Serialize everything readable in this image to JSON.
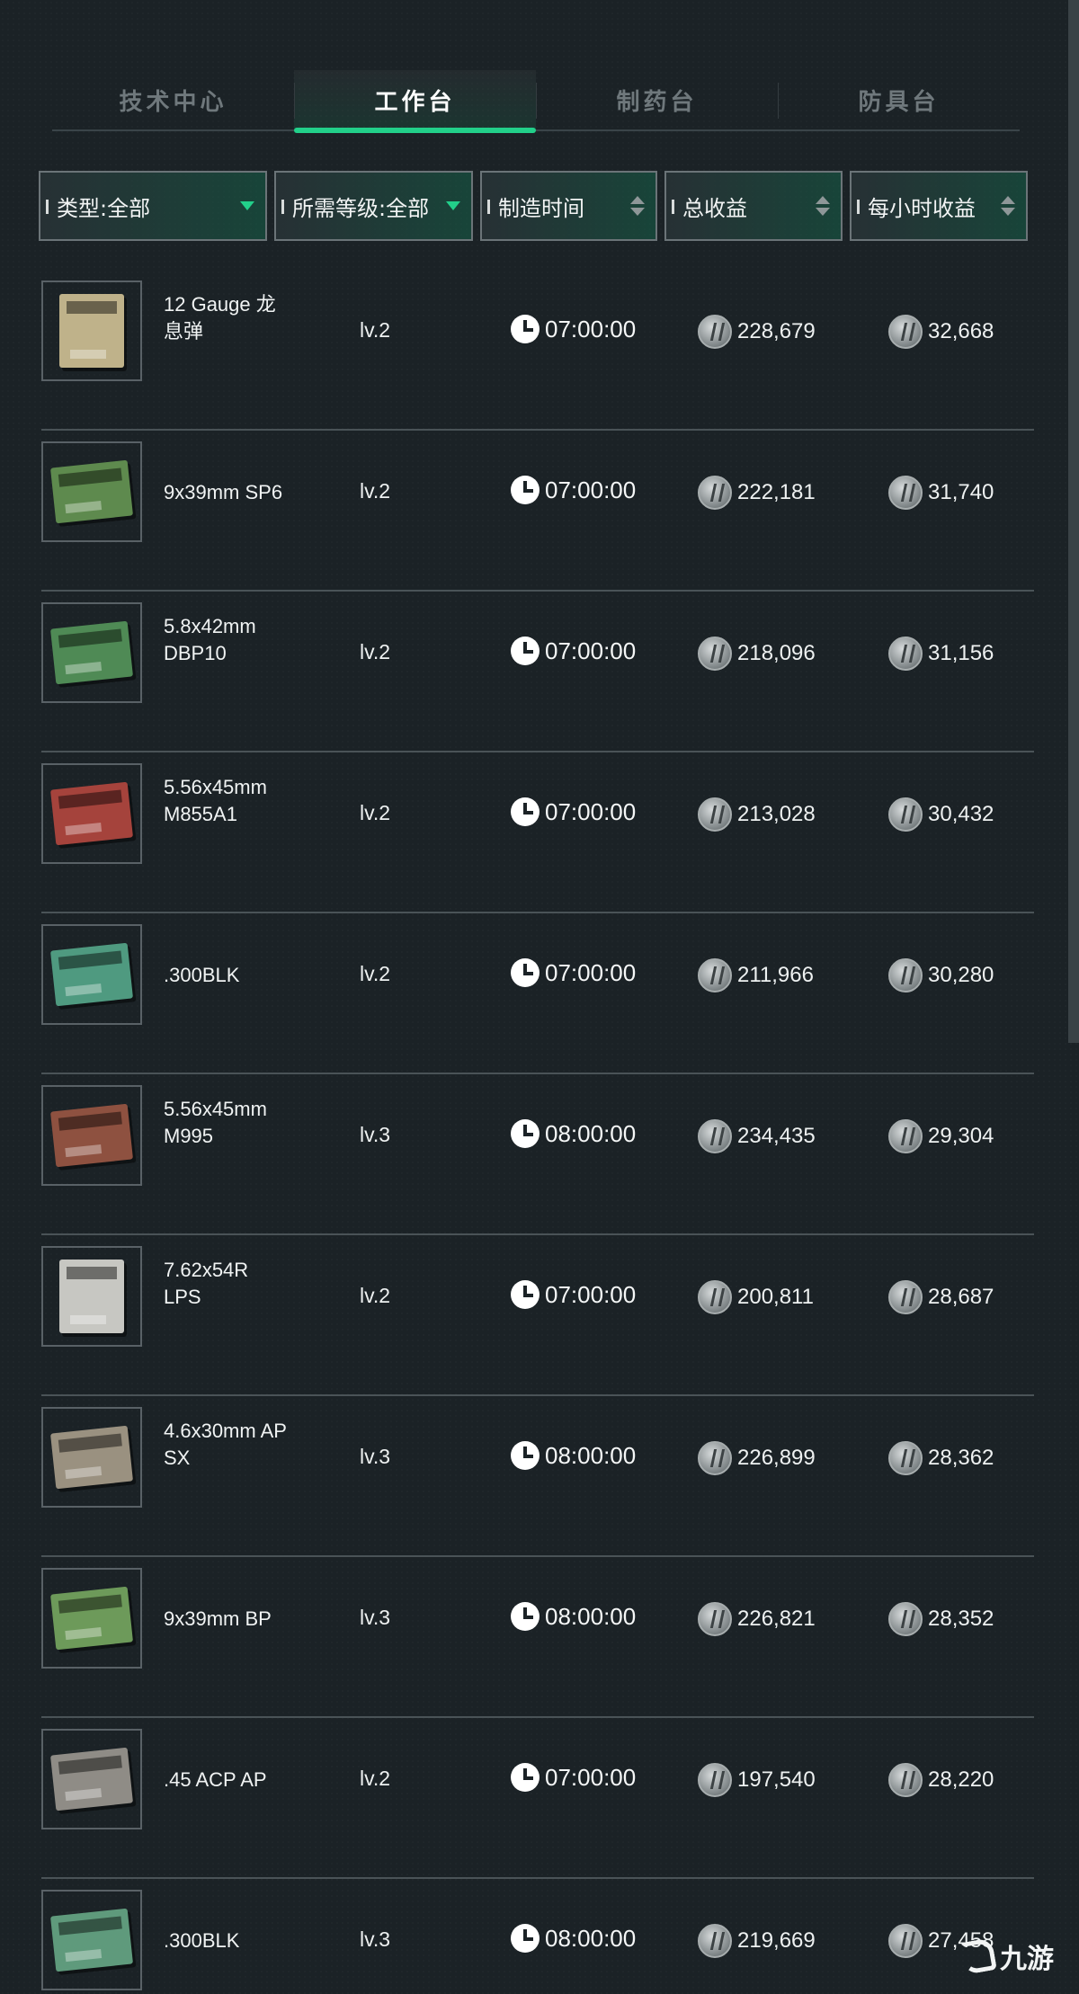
{
  "tabs": [
    {
      "label": "技术中心",
      "active": false
    },
    {
      "label": "工作台",
      "active": true
    },
    {
      "label": "制药台",
      "active": false
    },
    {
      "label": "防具台",
      "active": false
    }
  ],
  "filters": {
    "type": "类型:全部",
    "level": "所需等级:全部",
    "time": "制造时间",
    "total": "总收益",
    "hourly": "每小时收益"
  },
  "colors": {
    "accent": "#22d08a",
    "background": "#1b2226"
  },
  "rows": [
    {
      "name": "12 Gauge 龙息弹",
      "level": "lv.2",
      "time": "07:00:00",
      "total": "228,679",
      "hourly": "32,668",
      "box_color": "#bfb28a",
      "box_shape": "tall"
    },
    {
      "name": "9x39mm SP6",
      "level": "lv.2",
      "time": "07:00:00",
      "total": "222,181",
      "hourly": "31,740",
      "box_color": "#5e8a4e",
      "box_shape": "flat"
    },
    {
      "name": "5.8x42mm DBP10",
      "level": "lv.2",
      "time": "07:00:00",
      "total": "218,096",
      "hourly": "31,156",
      "box_color": "#4f8a55",
      "box_shape": "flat"
    },
    {
      "name": "5.56x45mm M855A1",
      "level": "lv.2",
      "time": "07:00:00",
      "total": "213,028",
      "hourly": "30,432",
      "box_color": "#a5433c",
      "box_shape": "flat"
    },
    {
      "name": ".300BLK",
      "level": "lv.2",
      "time": "07:00:00",
      "total": "211,966",
      "hourly": "30,280",
      "box_color": "#4f9a80",
      "box_shape": "flat"
    },
    {
      "name": "5.56x45mm M995",
      "level": "lv.3",
      "time": "08:00:00",
      "total": "234,435",
      "hourly": "29,304",
      "box_color": "#8e5140",
      "box_shape": "flat"
    },
    {
      "name": "7.62x54R LPS",
      "level": "lv.2",
      "time": "07:00:00",
      "total": "200,811",
      "hourly": "28,687",
      "box_color": "#c7c7c2",
      "box_shape": "tall"
    },
    {
      "name": "4.6x30mm AP SX",
      "level": "lv.3",
      "time": "08:00:00",
      "total": "226,899",
      "hourly": "28,362",
      "box_color": "#9a9180",
      "box_shape": "flat"
    },
    {
      "name": "9x39mm BP",
      "level": "lv.3",
      "time": "08:00:00",
      "total": "226,821",
      "hourly": "28,352",
      "box_color": "#6d9a5a",
      "box_shape": "flat"
    },
    {
      "name": ".45 ACP AP",
      "level": "lv.2",
      "time": "07:00:00",
      "total": "197,540",
      "hourly": "28,220",
      "box_color": "#8f8c86",
      "box_shape": "flat"
    },
    {
      "name": ".300BLK",
      "level": "lv.3",
      "time": "08:00:00",
      "total": "219,669",
      "hourly": "27,458",
      "box_color": "#5f9a7c",
      "box_shape": "flat"
    }
  ],
  "watermark": "九游"
}
